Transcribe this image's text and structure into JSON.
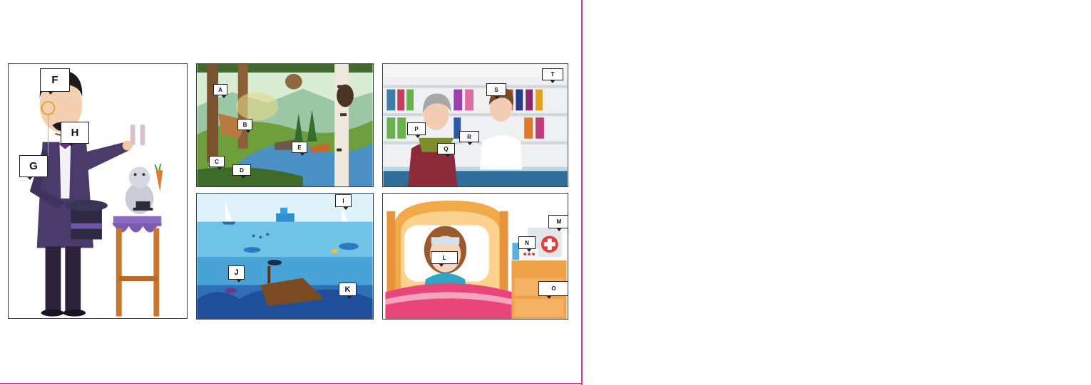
{
  "page": {
    "accent_color": "#d63c98"
  },
  "panels": {
    "magician": {
      "tags": {
        "F": "F",
        "G": "G",
        "H": "H"
      }
    },
    "forest": {
      "tags": {
        "A": "A",
        "B": "B",
        "C": "C",
        "D": "D",
        "E": "E"
      }
    },
    "pharmacy": {
      "tags": {
        "P": "P",
        "Q": "Q",
        "R": "R",
        "S": "S",
        "T": "T"
      }
    },
    "sea": {
      "tags": {
        "I": "I",
        "J": "J",
        "K": "K"
      }
    },
    "sick_girl": {
      "tags": {
        "L": "L",
        "M": "M",
        "N": "N",
        "O": "O"
      }
    }
  }
}
